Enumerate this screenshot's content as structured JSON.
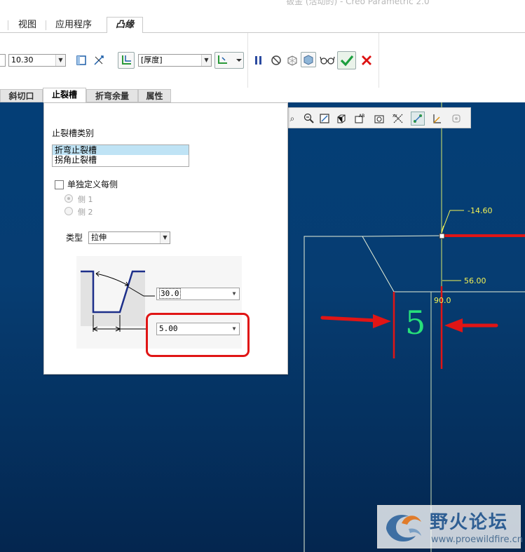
{
  "app": {
    "title": "钣金 (活动的) - Creo Parametric 2.0"
  },
  "ribbon_tabs": [
    {
      "label": "视图"
    },
    {
      "label": "应用程序"
    },
    {
      "label": "凸缘",
      "active": true
    }
  ],
  "toolbar": {
    "length_value": "10.30",
    "thickness_option": "[厚度]"
  },
  "feature_tabs": [
    {
      "label": "斜切口"
    },
    {
      "label": "止裂槽",
      "active": true
    },
    {
      "label": "折弯余量"
    },
    {
      "label": "属性"
    }
  ],
  "relief_panel": {
    "relief_category_label": "止裂槽类别",
    "relief_categories": [
      {
        "label": "折弯止裂槽",
        "selected": true
      },
      {
        "label": "拐角止裂槽",
        "selected": false
      }
    ],
    "define_each_side_label": "单独定义每侧",
    "define_each_side_checked": false,
    "side1_label": "侧 1",
    "side2_label": "侧 2",
    "type_label": "类型",
    "type_value": "拉伸",
    "angle_value": "30.0",
    "width_value": "5.00"
  },
  "viewport": {
    "dim_offset": "-14.60",
    "dim_length": "56.00",
    "dim_angle": "90.0",
    "annotation_number": "5"
  },
  "watermark": {
    "title": "野火论坛",
    "url": "www.proewildfire.cn"
  },
  "colors": {
    "canvas_top": "#043e76",
    "canvas_bottom": "#04264f",
    "geometry_line": "#e8f0d8",
    "dimension_text": "#f2f255",
    "highlight_red": "#e01515",
    "annotation_green": "#27e07a",
    "confirm_green": "#1b9e3e"
  }
}
